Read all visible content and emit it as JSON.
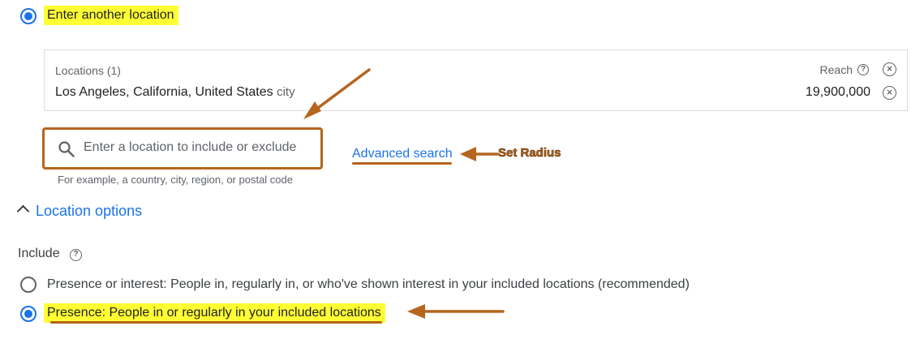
{
  "location_choice": {
    "label": "Enter another location"
  },
  "locations": {
    "header": "Locations (1)",
    "reach_label": "Reach",
    "items": [
      {
        "name": "Los Angeles, California, United States",
        "type": "city",
        "reach": "19,900,000"
      }
    ]
  },
  "search": {
    "placeholder": "Enter a location to include or exclude",
    "hint": "For example, a country, city, region, or postal code",
    "advanced_link": "Advanced search"
  },
  "annotation": {
    "set_radius": "Set Radius"
  },
  "location_options": {
    "toggle_label": "Location options",
    "include_label": "Include",
    "options": [
      {
        "label": "Presence or interest: People in, regularly in, or who've shown interest in your included locations (recommended)",
        "selected": false
      },
      {
        "label": "Presence: People in or regularly in your included locations",
        "selected": true
      }
    ]
  },
  "colors": {
    "accent": "#1a73e8",
    "highlight": "#ffff33",
    "annotation": "#b5651d"
  },
  "icons": [
    "radio-checked-icon",
    "help-icon",
    "remove-icon",
    "search-icon",
    "chevron-up-icon",
    "arrow-annotation"
  ]
}
